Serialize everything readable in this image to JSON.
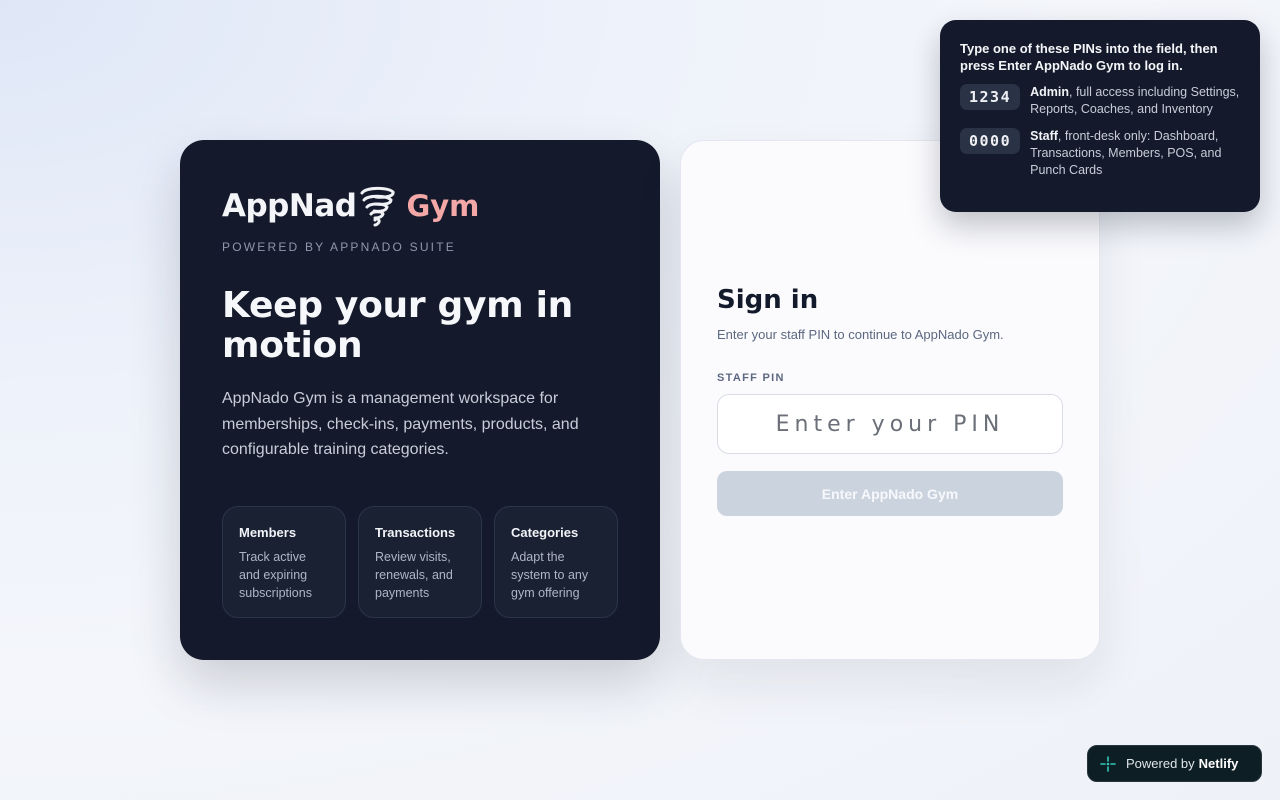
{
  "brand": {
    "name_part1": "AppNad",
    "name_part2": "Gym",
    "powered_by": "POWERED BY APPNADO SUITE"
  },
  "hero": {
    "headline": "Keep your gym in motion",
    "description": "AppNado Gym is a management workspace for memberships, check-ins, payments, products, and configurable training categories."
  },
  "features": [
    {
      "title": "Members",
      "desc": "Track active and expiring subscriptions"
    },
    {
      "title": "Transactions",
      "desc": "Review visits, renewals, and payments"
    },
    {
      "title": "Categories",
      "desc": "Adapt the system to any gym offering"
    }
  ],
  "signin": {
    "title": "Sign in",
    "subtitle": "Enter your staff PIN to continue to AppNado Gym.",
    "pin_label": "STAFF PIN",
    "pin_placeholder": "Enter your PIN",
    "pin_value": "",
    "button_label": "Enter AppNado Gym"
  },
  "tooltip": {
    "heading": "Type one of these PINs into the field, then press Enter AppNado Gym to log in.",
    "pins": [
      {
        "pin": "1234",
        "role": "Admin",
        "detail": ", full access including Settings, Reports, Coaches, and Inventory"
      },
      {
        "pin": "0000",
        "role": "Staff",
        "detail": ", front-desk only: Dashboard, Transactions, Members, POS, and Punch Cards"
      }
    ]
  },
  "netlify_badge": {
    "prefix": "Powered by",
    "name": "Netlify"
  },
  "colors": {
    "dark_card": "#141a2b",
    "brand_accent": "#f3a7a7",
    "button_disabled": "#cbd3de"
  },
  "icons": [
    "tornado-logo-icon",
    "netlify-icon"
  ]
}
